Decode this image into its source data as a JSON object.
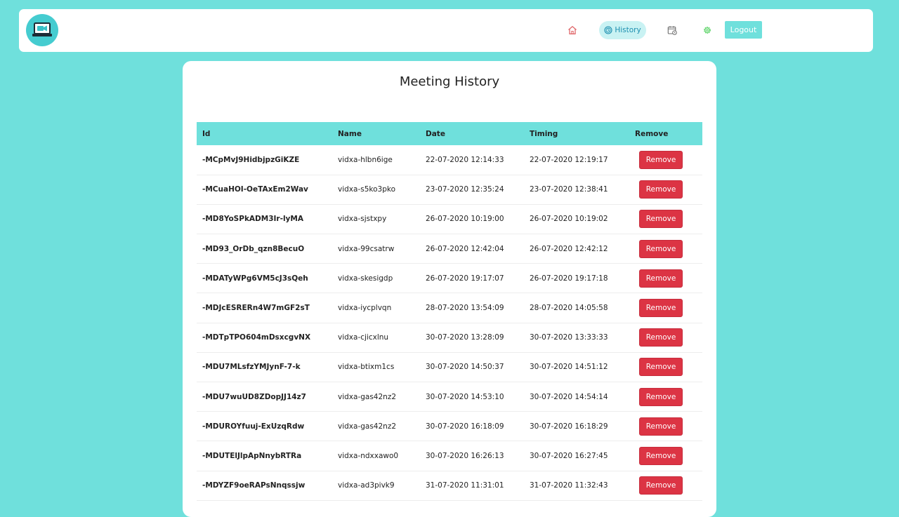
{
  "nav": {
    "history_label": "History",
    "logout_label": "Logout",
    "colors": {
      "accent": "#6fe0dc",
      "home_icon": "#e0686b",
      "history_text": "#1d8fb0",
      "settings_icon": "#5fd46a"
    }
  },
  "page": {
    "title": "Meeting History"
  },
  "table": {
    "headers": {
      "id": "Id",
      "name": "Name",
      "date": "Date",
      "timing": "Timing",
      "remove": "Remove"
    },
    "remove_label": "Remove",
    "rows": [
      {
        "id": "-MCpMvJ9HidbjpzGiKZE",
        "name": "vidxa-hlbn6ige",
        "date": "22-07-2020 12:14:33",
        "timing": "22-07-2020 12:19:17"
      },
      {
        "id": "-MCuaHOI-OeTAxEm2Wav",
        "name": "vidxa-s5ko3pko",
        "date": "23-07-2020 12:35:24",
        "timing": "23-07-2020 12:38:41"
      },
      {
        "id": "-MD8YoSPkADM3Ir-lyMA",
        "name": "vidxa-sjstxpy",
        "date": "26-07-2020 10:19:00",
        "timing": "26-07-2020 10:19:02"
      },
      {
        "id": "-MD93_OrDb_qzn8BecuO",
        "name": "vidxa-99csatrw",
        "date": "26-07-2020 12:42:04",
        "timing": "26-07-2020 12:42:12"
      },
      {
        "id": "-MDATyWPg6VM5cJ3sQeh",
        "name": "vidxa-skesigdp",
        "date": "26-07-2020 19:17:07",
        "timing": "26-07-2020 19:17:18"
      },
      {
        "id": "-MDJcESRERn4W7mGF2sT",
        "name": "vidxa-iycplvqn",
        "date": "28-07-2020 13:54:09",
        "timing": "28-07-2020 14:05:58"
      },
      {
        "id": "-MDTpTPO604mDsxcgvNX",
        "name": "vidxa-cjicxlnu",
        "date": "30-07-2020 13:28:09",
        "timing": "30-07-2020 13:33:33"
      },
      {
        "id": "-MDU7MLsfzYMJynF-7-k",
        "name": "vidxa-btixm1cs",
        "date": "30-07-2020 14:50:37",
        "timing": "30-07-2020 14:51:12"
      },
      {
        "id": "-MDU7wuUD8ZDopJJ14z7",
        "name": "vidxa-gas42nz2",
        "date": "30-07-2020 14:53:10",
        "timing": "30-07-2020 14:54:14"
      },
      {
        "id": "-MDUROYfuuj-ExUzqRdw",
        "name": "vidxa-gas42nz2",
        "date": "30-07-2020 16:18:09",
        "timing": "30-07-2020 16:18:29"
      },
      {
        "id": "-MDUTElJlpApNnybRTRa",
        "name": "vidxa-ndxxawo0",
        "date": "30-07-2020 16:26:13",
        "timing": "30-07-2020 16:27:45"
      },
      {
        "id": "-MDYZF9oeRAPsNnqssjw",
        "name": "vidxa-ad3pivk9",
        "date": "31-07-2020 11:31:01",
        "timing": "31-07-2020 11:32:43"
      }
    ]
  }
}
